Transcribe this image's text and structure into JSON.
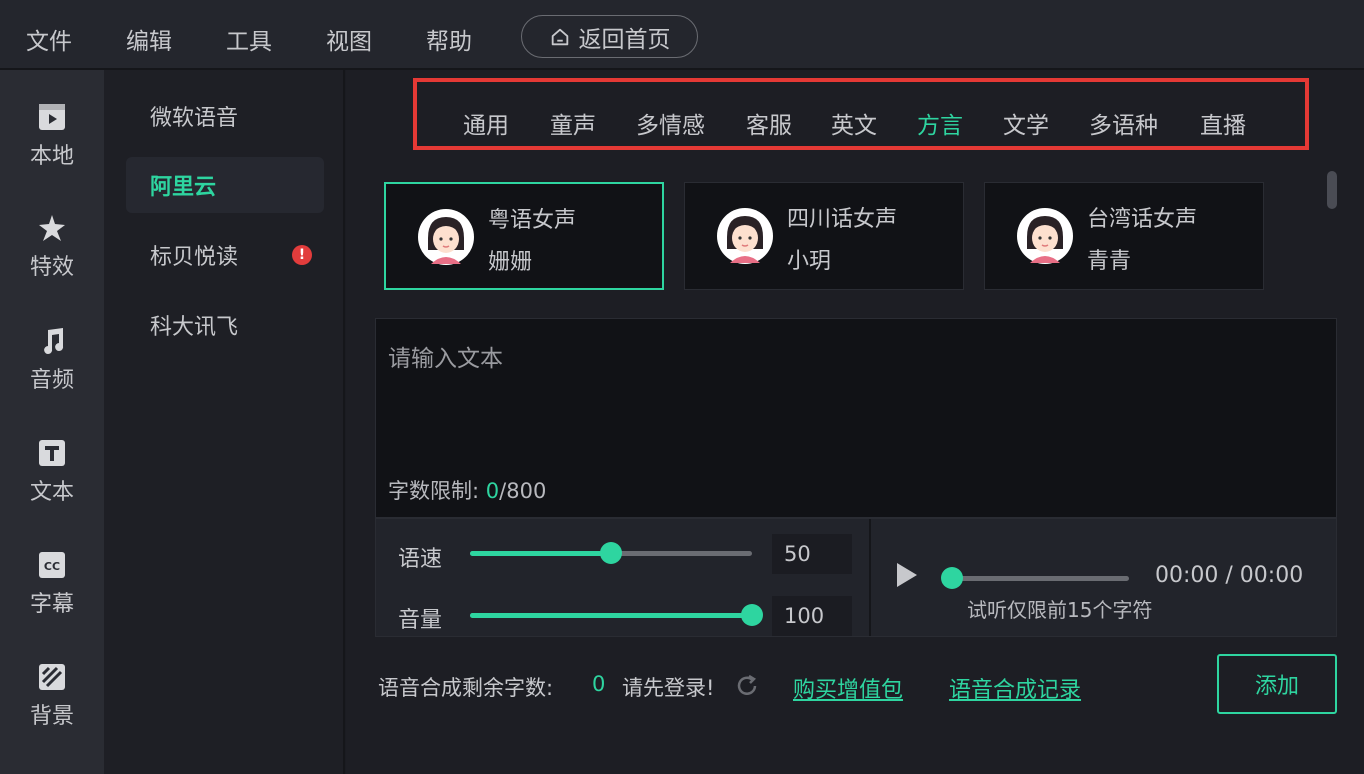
{
  "menubar": {
    "items": [
      "文件",
      "编辑",
      "工具",
      "视图",
      "帮助"
    ],
    "home_label": "返回首页"
  },
  "leftnav": {
    "items": [
      {
        "label": "本地",
        "icon": "media-icon"
      },
      {
        "label": "特效",
        "icon": "effects-star-icon"
      },
      {
        "label": "音频",
        "icon": "music-note-icon"
      },
      {
        "label": "文本",
        "icon": "text-t-icon"
      },
      {
        "label": "字幕",
        "icon": "cc-icon"
      },
      {
        "label": "背景",
        "icon": "background-icon"
      }
    ]
  },
  "providers": {
    "items": [
      "微软语音",
      "阿里云",
      "标贝悦读",
      "科大讯飞"
    ],
    "active": "阿里云",
    "badge": "!"
  },
  "categories": {
    "items": [
      "通用",
      "童声",
      "多情感",
      "客服",
      "英文",
      "方言",
      "文学",
      "多语种",
      "直播"
    ],
    "active": "方言"
  },
  "voices": [
    {
      "name": "粤语女声",
      "sub": "姗姗",
      "selected": true
    },
    {
      "name": "四川话女声",
      "sub": "小玥",
      "selected": false
    },
    {
      "name": "台湾话女声",
      "sub": "青青",
      "selected": false
    }
  ],
  "editor": {
    "placeholder": "请输入文本",
    "limit_label": "字数限制: ",
    "limit_count": "0",
    "limit_max": "/800"
  },
  "controls": {
    "speed_label": "语速",
    "speed_value": "50",
    "speed_fraction": 0.5,
    "volume_label": "音量",
    "volume_value": "100",
    "volume_fraction": 1.0,
    "time": "00:00 / 00:00",
    "preview_note": "试听仅限前15个字符"
  },
  "footer": {
    "remaining_label": "语音合成剩余字数:",
    "remaining_count": "0",
    "login_prompt": "请先登录!",
    "buy_link": "购买增值包",
    "history_link": "语音合成记录",
    "add_label": "添加"
  },
  "colors": {
    "accent": "#2ed5a0",
    "highlight_box": "#e53935"
  }
}
